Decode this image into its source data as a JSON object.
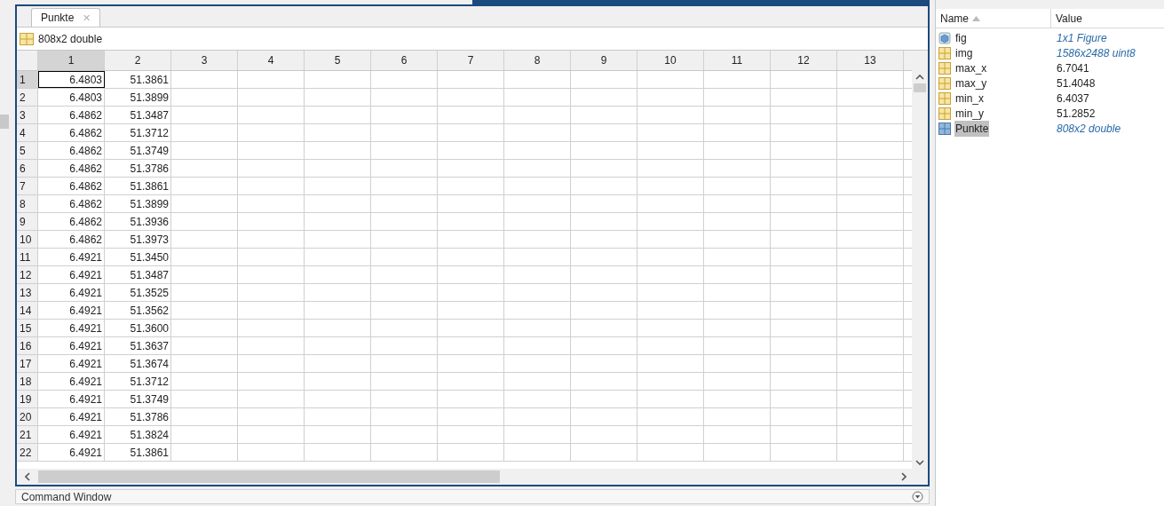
{
  "editor": {
    "tab": {
      "label": "Punkte",
      "close": "✕"
    },
    "summary": "808x2 double",
    "columns": [
      {
        "label": "1",
        "selected": true
      },
      {
        "label": "2",
        "selected": false
      },
      {
        "label": "3",
        "selected": false
      },
      {
        "label": "4",
        "selected": false
      },
      {
        "label": "5",
        "selected": false
      },
      {
        "label": "6",
        "selected": false
      },
      {
        "label": "7",
        "selected": false
      },
      {
        "label": "8",
        "selected": false
      },
      {
        "label": "9",
        "selected": false
      },
      {
        "label": "10",
        "selected": false
      },
      {
        "label": "11",
        "selected": false
      },
      {
        "label": "12",
        "selected": false
      },
      {
        "label": "13",
        "selected": false
      }
    ],
    "rows": [
      {
        "index": "1",
        "cells": [
          "6.4803",
          "51.3861"
        ],
        "selected": true
      },
      {
        "index": "2",
        "cells": [
          "6.4803",
          "51.3899"
        ],
        "selected": false
      },
      {
        "index": "3",
        "cells": [
          "6.4862",
          "51.3487"
        ],
        "selected": false
      },
      {
        "index": "4",
        "cells": [
          "6.4862",
          "51.3712"
        ],
        "selected": false
      },
      {
        "index": "5",
        "cells": [
          "6.4862",
          "51.3749"
        ],
        "selected": false
      },
      {
        "index": "6",
        "cells": [
          "6.4862",
          "51.3786"
        ],
        "selected": false
      },
      {
        "index": "7",
        "cells": [
          "6.4862",
          "51.3861"
        ],
        "selected": false
      },
      {
        "index": "8",
        "cells": [
          "6.4862",
          "51.3899"
        ],
        "selected": false
      },
      {
        "index": "9",
        "cells": [
          "6.4862",
          "51.3936"
        ],
        "selected": false
      },
      {
        "index": "10",
        "cells": [
          "6.4862",
          "51.3973"
        ],
        "selected": false
      },
      {
        "index": "11",
        "cells": [
          "6.4921",
          "51.3450"
        ],
        "selected": false
      },
      {
        "index": "12",
        "cells": [
          "6.4921",
          "51.3487"
        ],
        "selected": false
      },
      {
        "index": "13",
        "cells": [
          "6.4921",
          "51.3525"
        ],
        "selected": false
      },
      {
        "index": "14",
        "cells": [
          "6.4921",
          "51.3562"
        ],
        "selected": false
      },
      {
        "index": "15",
        "cells": [
          "6.4921",
          "51.3600"
        ],
        "selected": false
      },
      {
        "index": "16",
        "cells": [
          "6.4921",
          "51.3637"
        ],
        "selected": false
      },
      {
        "index": "17",
        "cells": [
          "6.4921",
          "51.3674"
        ],
        "selected": false
      },
      {
        "index": "18",
        "cells": [
          "6.4921",
          "51.3712"
        ],
        "selected": false
      },
      {
        "index": "19",
        "cells": [
          "6.4921",
          "51.3749"
        ],
        "selected": false
      },
      {
        "index": "20",
        "cells": [
          "6.4921",
          "51.3786"
        ],
        "selected": false
      },
      {
        "index": "21",
        "cells": [
          "6.4921",
          "51.3824"
        ],
        "selected": false
      },
      {
        "index": "22",
        "cells": [
          "6.4921",
          "51.3861"
        ],
        "selected": false
      }
    ]
  },
  "command_window": {
    "title": "Command Window"
  },
  "workspace": {
    "columns": [
      "Name",
      "Value"
    ],
    "items": [
      {
        "kind": "figure",
        "name": "fig",
        "value": "1x1 Figure",
        "italic": true,
        "selected": false
      },
      {
        "kind": "matrix",
        "name": "img",
        "value": "1586x2488 uint8",
        "italic": true,
        "selected": false
      },
      {
        "kind": "matrix",
        "name": "max_x",
        "value": "6.7041",
        "italic": false,
        "selected": false
      },
      {
        "kind": "matrix",
        "name": "max_y",
        "value": "51.4048",
        "italic": false,
        "selected": false
      },
      {
        "kind": "matrix",
        "name": "min_x",
        "value": "6.4037",
        "italic": false,
        "selected": false
      },
      {
        "kind": "matrix",
        "name": "min_y",
        "value": "51.2852",
        "italic": false,
        "selected": false
      },
      {
        "kind": "table",
        "name": "Punkte",
        "value": "808x2 double",
        "italic": true,
        "selected": true
      }
    ]
  }
}
